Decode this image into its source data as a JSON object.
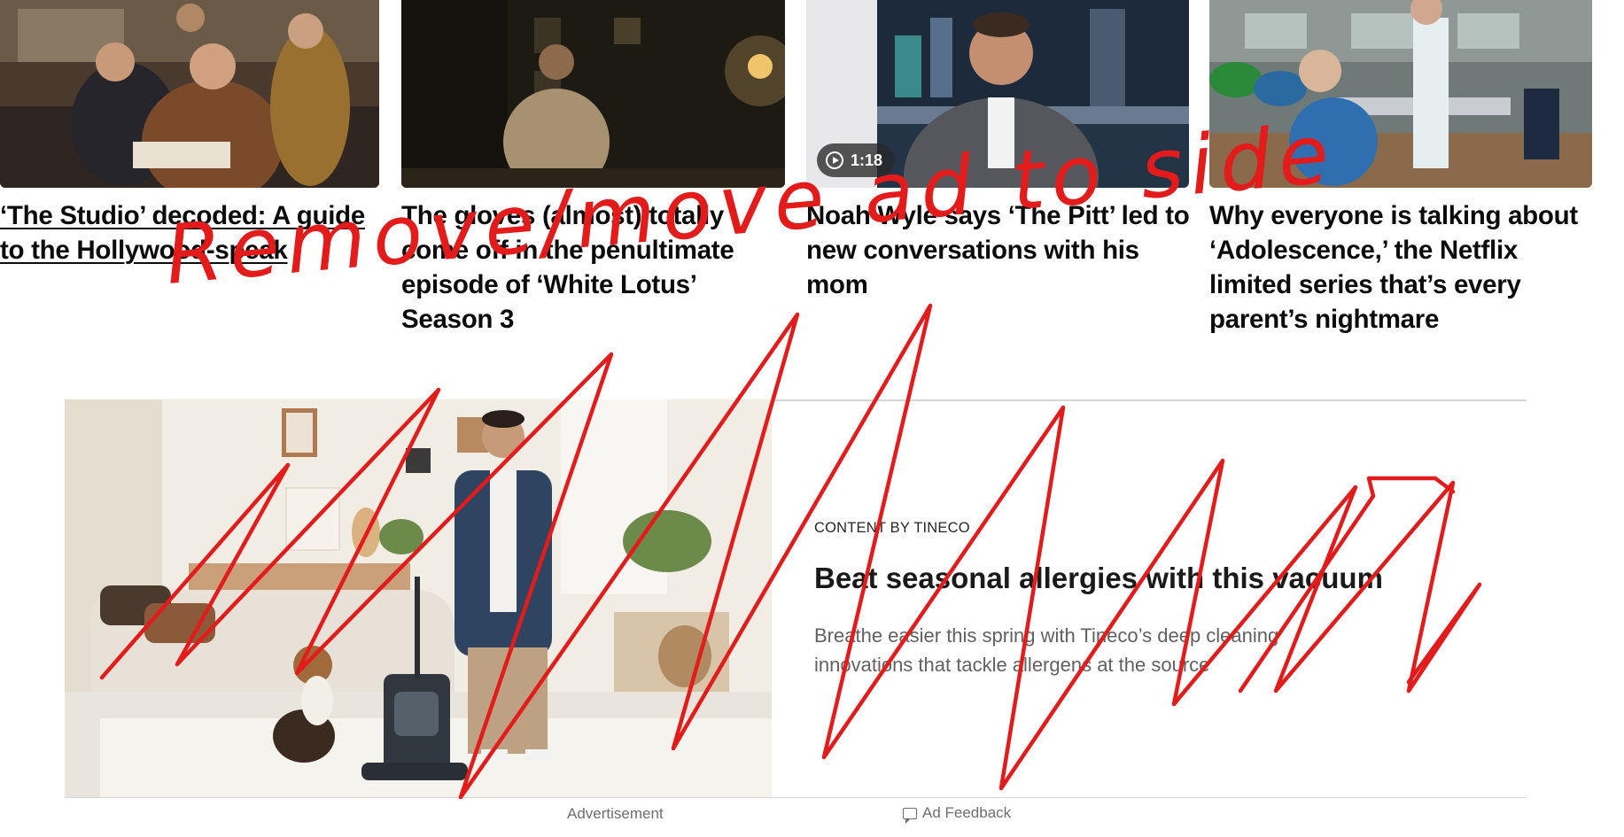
{
  "cards": [
    {
      "headline": "‘The Studio’ decoded: A guide to the Hollywood-speak"
    },
    {
      "headline": "The gloves (almost) totally come off in the penultimate episode of ‘White Lotus’ Season 3"
    },
    {
      "headline": "Noah Wyle says ‘The Pitt’ led to new conversations with his mom",
      "duration": "1:18"
    },
    {
      "headline": "Why everyone is talking about ‘Adolescence,’ the Netflix limited series that’s every parent’s nightmare"
    }
  ],
  "ad": {
    "kicker": "CONTENT BY TINECO",
    "title": "Beat seasonal allergies with this vacuum",
    "description": "Breathe easier this spring with Tineco’s deep cleaning innovations that tackle allergens at the source",
    "label": "Advertisement",
    "feedback": "Ad Feedback"
  },
  "annotation": {
    "text": "Remove/move ad to side",
    "color": "#e31b1b"
  }
}
